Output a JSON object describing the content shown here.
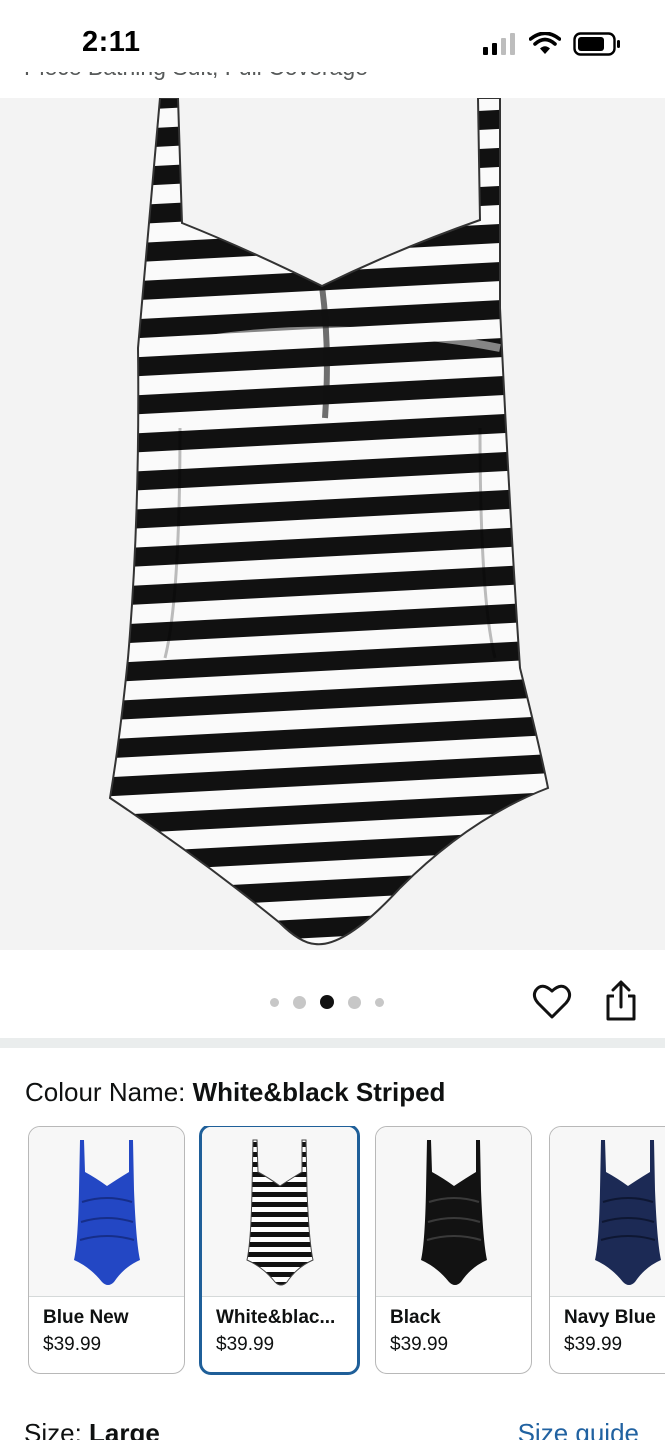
{
  "status_bar": {
    "time": "2:11"
  },
  "product": {
    "title_fragment": "Piece Bathing Suit, Full Coverage"
  },
  "gallery": {
    "dot_count": 5,
    "active_index": 2
  },
  "colour": {
    "label": "Colour Name: ",
    "selected": "White&black Striped",
    "options": [
      {
        "name": "Blue New",
        "price": "$39.99",
        "color": "#2347c4"
      },
      {
        "name": "White&blac...",
        "price": "$39.99",
        "color": "striped"
      },
      {
        "name": "Black",
        "price": "$39.99",
        "color": "#121212"
      },
      {
        "name": "Navy Blue",
        "price": "$39.99",
        "color": "#1c2a55"
      }
    ]
  },
  "size": {
    "label": "Size: ",
    "selected": "Large",
    "guide_link": "Size guide"
  },
  "colors": {
    "link": "#2162a1",
    "selected_border": "#1f5f99"
  }
}
